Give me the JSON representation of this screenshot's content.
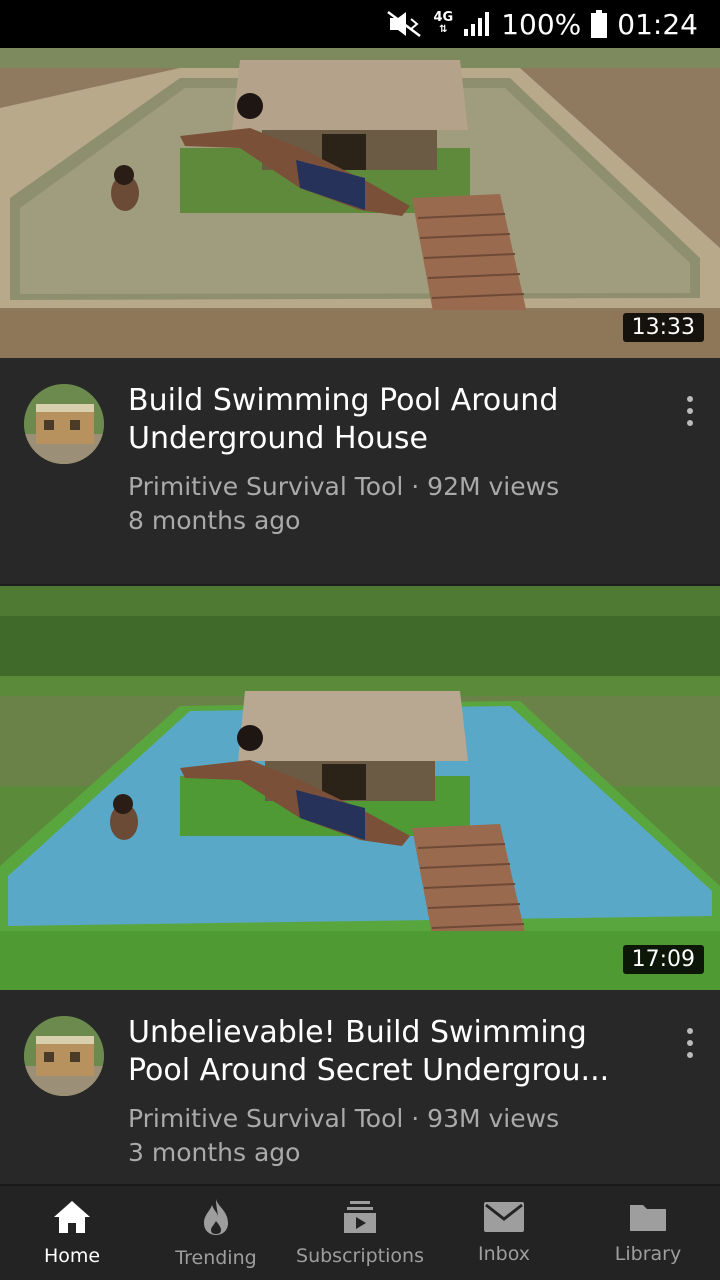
{
  "status_bar": {
    "network": "4G",
    "battery": "100%",
    "time": "01:24",
    "icons": [
      "mute-icon",
      "network-4g-icon",
      "signal-icon",
      "battery-icon"
    ]
  },
  "videos": [
    {
      "duration": "13:33",
      "title_line1": "Build Swimming Pool Around",
      "title_line2": "Underground House",
      "channel_views": "Primitive Survival Tool · 92M views",
      "age": "8 months ago"
    },
    {
      "duration": "17:09",
      "title_line1": "Unbelievable! Build Swimming",
      "title_line2": "Pool Around Secret Undergrou...",
      "channel_views": "Primitive Survival Tool · 93M views",
      "age": "3 months ago"
    }
  ],
  "nav": {
    "items": [
      {
        "label": "Home",
        "icon": "home-icon",
        "active": true
      },
      {
        "label": "Trending",
        "icon": "flame-icon",
        "active": false
      },
      {
        "label": "Subscriptions",
        "icon": "subscriptions-icon",
        "active": false
      },
      {
        "label": "Inbox",
        "icon": "mail-icon",
        "active": false
      },
      {
        "label": "Library",
        "icon": "folder-icon",
        "active": false
      }
    ]
  },
  "colors": {
    "background": "#282828",
    "nav_bg": "#232323",
    "secondary_text": "#aaaaaa"
  }
}
